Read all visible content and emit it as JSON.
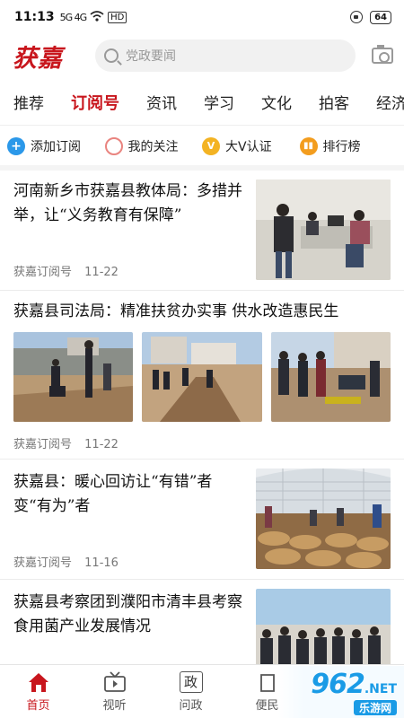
{
  "status": {
    "time": "11:13",
    "signal": "5G 4G",
    "battery": "64"
  },
  "header": {
    "logo": "获嘉",
    "search_placeholder": "党政要闻"
  },
  "tabs": [
    {
      "label": "推荐",
      "active": false
    },
    {
      "label": "订阅号",
      "active": true
    },
    {
      "label": "资讯",
      "active": false
    },
    {
      "label": "学习",
      "active": false
    },
    {
      "label": "文化",
      "active": false
    },
    {
      "label": "拍客",
      "active": false
    },
    {
      "label": "经济",
      "active": false
    }
  ],
  "quick_actions": [
    {
      "label": "添加订阅",
      "icon": "plus-icon",
      "glyph": "+"
    },
    {
      "label": "我的关注",
      "icon": "follow-icon",
      "glyph": ""
    },
    {
      "label": "大V认证",
      "icon": "verify-icon",
      "glyph": "V"
    },
    {
      "label": "排行榜",
      "icon": "rank-icon",
      "glyph": "▮▮"
    }
  ],
  "articles": [
    {
      "title": "河南新乡市获嘉县教体局：多措并举，让“义务教育有保障”",
      "source": "获嘉订阅号",
      "date": "11-22",
      "image": "people-in-office-photo"
    },
    {
      "title": "获嘉县司法局：精准扶贫办实事 供水改造惠民生",
      "source": "获嘉订阅号",
      "date": "11-22",
      "images": [
        "village-pipe-work-photo-1",
        "village-pipe-work-photo-2",
        "village-pipe-work-photo-3"
      ]
    },
    {
      "title": "获嘉县：暖心回访让“有错”者变“有为”者",
      "source": "获嘉订阅号",
      "date": "11-16",
      "image": "greenhouse-mushroom-photo"
    },
    {
      "title": "获嘉县考察团到濮阳市清丰县考察食用菌产业发展情况",
      "source": "",
      "date": "",
      "image": "delegation-group-photo"
    }
  ],
  "bottom_nav": [
    {
      "label": "首页",
      "icon": "home-icon",
      "active": true
    },
    {
      "label": "视听",
      "icon": "tv-icon",
      "active": false
    },
    {
      "label": "问政",
      "icon": "gov-icon",
      "glyph": "政",
      "active": false
    },
    {
      "label": "便民",
      "icon": "service-icon",
      "active": false
    }
  ],
  "watermark": {
    "text": "962",
    "sub": ".NET",
    "site": "乐游网"
  },
  "colors": {
    "accent": "#c8161d",
    "muted": "#777777"
  }
}
